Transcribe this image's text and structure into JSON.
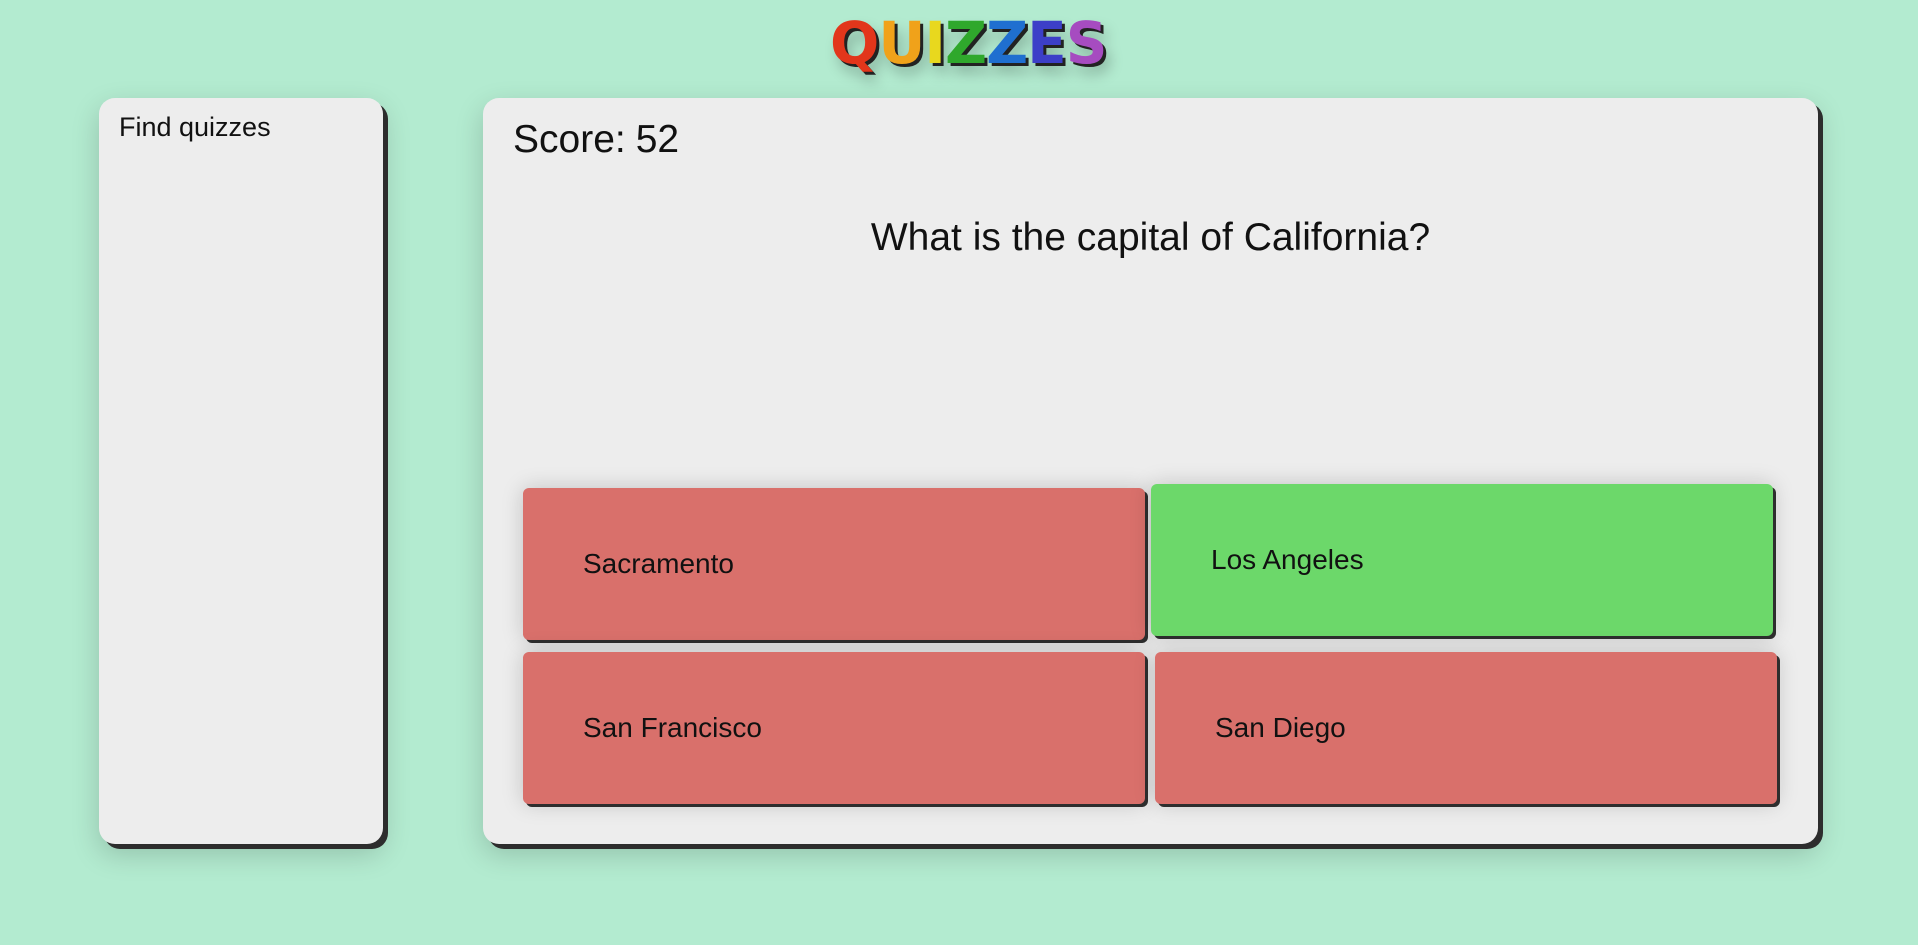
{
  "header": {
    "logo_letters": [
      {
        "char": "Q",
        "color": "#e2361b"
      },
      {
        "char": "U",
        "color": "#f0a21a"
      },
      {
        "char": "I",
        "color": "#e8d81e"
      },
      {
        "char": "Z",
        "color": "#2fa82c"
      },
      {
        "char": "Z",
        "color": "#1f6fd0"
      },
      {
        "char": "E",
        "color": "#3c3fc8"
      },
      {
        "char": "S",
        "color": "#a64cc0"
      }
    ]
  },
  "sidebar": {
    "title": "Find quizzes"
  },
  "quiz": {
    "score_label": "Score:",
    "score_value": "52",
    "question": "What is the capital of California?",
    "answers": [
      {
        "label": "Sacramento",
        "state": "wrong",
        "color": "#d9706b"
      },
      {
        "label": "Los Angeles",
        "state": "correct",
        "color": "#6cd86a"
      },
      {
        "label": "San Francisco",
        "state": "wrong",
        "color": "#d9706b"
      },
      {
        "label": "San Diego",
        "state": "wrong",
        "color": "#d9706b"
      }
    ]
  },
  "colors": {
    "background": "#b3ebd0",
    "panel": "#ededed"
  }
}
